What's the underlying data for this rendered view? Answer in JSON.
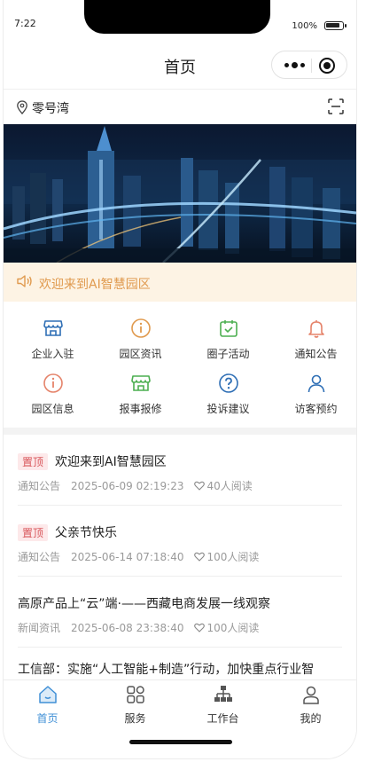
{
  "status": {
    "time": "7:22",
    "battery": "100%"
  },
  "nav": {
    "title": "首页"
  },
  "location": {
    "name": "零号湾",
    "pin_icon": "location-pin-icon",
    "scan_icon": "scan-icon"
  },
  "banner": {
    "alt": ""
  },
  "notice": {
    "text": "欢迎来到AI智慧园区",
    "icon": "speaker-icon"
  },
  "services": [
    {
      "label": "企业入驻",
      "icon": "store-icon",
      "color": "#2f6fb5"
    },
    {
      "label": "园区资讯",
      "icon": "info-icon",
      "color": "#e09a4e"
    },
    {
      "label": "圈子活动",
      "icon": "calendar-check-icon",
      "color": "#4caf50"
    },
    {
      "label": "通知公告",
      "icon": "bell-icon",
      "color": "#e5836a"
    },
    {
      "label": "园区信息",
      "icon": "info-icon",
      "color": "#e5836a"
    },
    {
      "label": "报事报修",
      "icon": "store-icon",
      "color": "#4caf50"
    },
    {
      "label": "投诉建议",
      "icon": "question-icon",
      "color": "#2f6fb5"
    },
    {
      "label": "访客预约",
      "icon": "person-icon",
      "color": "#2f6fb5"
    }
  ],
  "news": [
    {
      "tag": "置顶",
      "title": "欢迎来到AI智慧园区",
      "category": "通知公告",
      "date": "2025-06-09 02:19:23",
      "reads": "40人阅读"
    },
    {
      "tag": "置顶",
      "title": "父亲节快乐",
      "category": "通知公告",
      "date": "2025-06-14 07:18:40",
      "reads": "100人阅读"
    },
    {
      "tag": "",
      "title": "高原产品上“云”端·——西藏电商发展一线观察",
      "category": "新闻资讯",
      "date": "2025-06-08 23:38:40",
      "reads": "100人阅读"
    },
    {
      "tag": "",
      "title": "工信部：实施“人工智能+制造”行动，加快重点行业智",
      "category": "",
      "date": "",
      "reads": ""
    }
  ],
  "tabbar": [
    {
      "label": "首页",
      "icon": "home-icon",
      "active": true
    },
    {
      "label": "服务",
      "icon": "grid-icon",
      "active": false
    },
    {
      "label": "工作台",
      "icon": "org-chart-icon",
      "active": false
    },
    {
      "label": "我的",
      "icon": "user-icon",
      "active": false
    }
  ],
  "colors": {
    "accent": "#3f8fd6",
    "notice_bg": "#fdf3e4",
    "notice_text": "#e09a4e",
    "tag_text": "#d8555a",
    "tag_bg": "#fde9ea"
  }
}
